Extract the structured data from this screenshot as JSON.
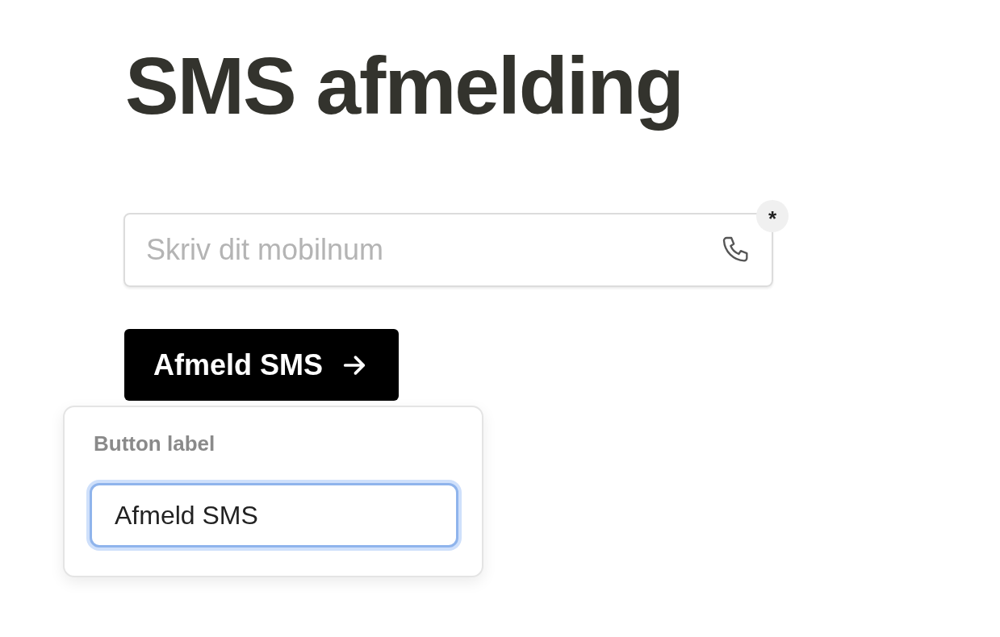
{
  "title": "SMS afmelding",
  "phone_field": {
    "placeholder": "Skriv dit mobilnum",
    "required_mark": "*"
  },
  "submit_button": {
    "label": "Afmeld SMS"
  },
  "label_editor": {
    "label": "Button label",
    "value": "Afmeld SMS",
    "focused": true
  }
}
